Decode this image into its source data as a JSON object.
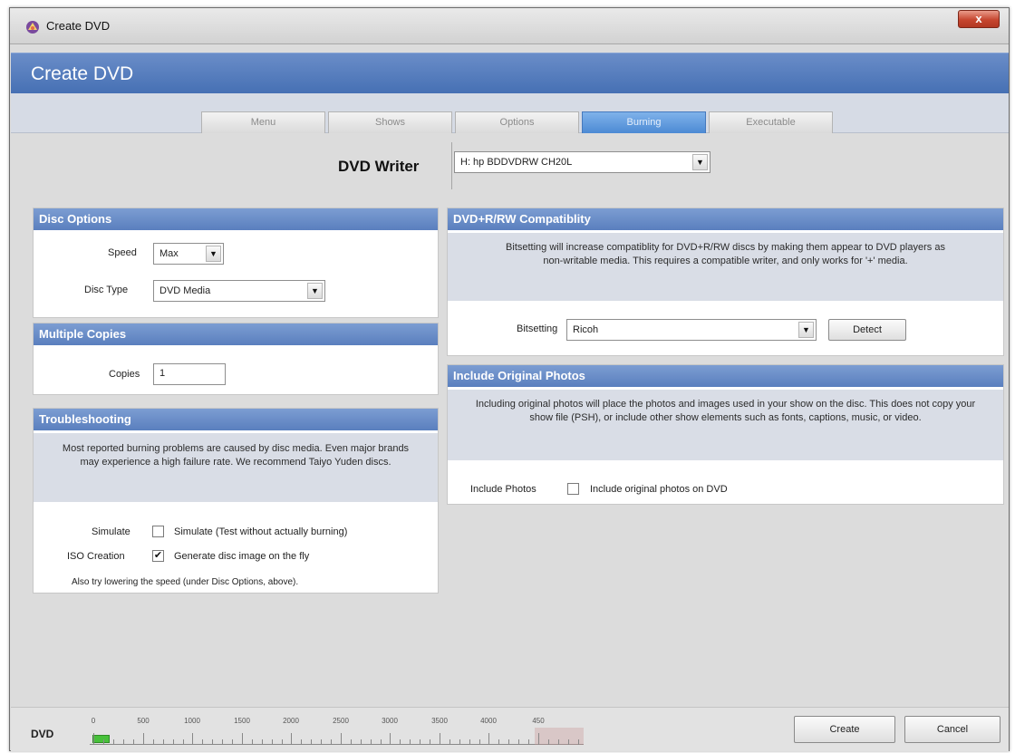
{
  "window": {
    "title": "Create DVD",
    "close_label": "x",
    "heading": "Create DVD"
  },
  "tabs": [
    {
      "label": "Menu",
      "active": false
    },
    {
      "label": "Shows",
      "active": false
    },
    {
      "label": "Options",
      "active": false
    },
    {
      "label": "Burning",
      "active": true
    },
    {
      "label": "Executable",
      "active": false
    }
  ],
  "writer": {
    "label": "DVD Writer",
    "value": "H: hp BDDVDRW CH20L"
  },
  "disc_options": {
    "title": "Disc Options",
    "speed_label": "Speed",
    "speed_value": "Max",
    "disc_type_label": "Disc Type",
    "disc_type_value": "DVD Media"
  },
  "multiple_copies": {
    "title": "Multiple Copies",
    "copies_label": "Copies",
    "copies_value": "1"
  },
  "troubleshooting": {
    "title": "Troubleshooting",
    "info": "Most reported burning problems are caused by disc media. Even major brands may experience a high failure rate. We recommend Taiyo Yuden discs.",
    "simulate_label": "Simulate",
    "simulate_text": "Simulate (Test without actually burning)",
    "simulate_checked": false,
    "iso_label": "ISO Creation",
    "iso_text": "Generate disc image on the fly",
    "iso_checked": true,
    "note": "Also try lowering the speed (under Disc Options, above)."
  },
  "compat": {
    "title": "DVD+R/RW Compatiblity",
    "info": "Bitsetting will increase compatiblity for DVD+R/RW discs by making them appear to DVD players as non-writable media. This requires a compatible writer, and only works for '+' media.",
    "bitsetting_label": "Bitsetting",
    "bitsetting_value": "Ricoh",
    "detect_label": "Detect"
  },
  "photos": {
    "title": "Include Original Photos",
    "info": "Including original photos will place the photos and images used in your show on the disc. This does not copy your show file (PSH), or include other show elements such as fonts, captions, music, or video.",
    "include_label": "Include Photos",
    "include_text": "Include original photos on DVD",
    "include_checked": false
  },
  "footer": {
    "dvd_label": "DVD",
    "ruler_ticks": [
      "0",
      "500",
      "1000",
      "1500",
      "2000",
      "2500",
      "3000",
      "3500",
      "4000",
      "450"
    ],
    "usage_fraction": 0.035,
    "create_label": "Create",
    "cancel_label": "Cancel"
  },
  "colors": {
    "accent": "#5a7fbe",
    "active_tab": "#4c8ad4",
    "usage_bar": "#47c13a"
  }
}
